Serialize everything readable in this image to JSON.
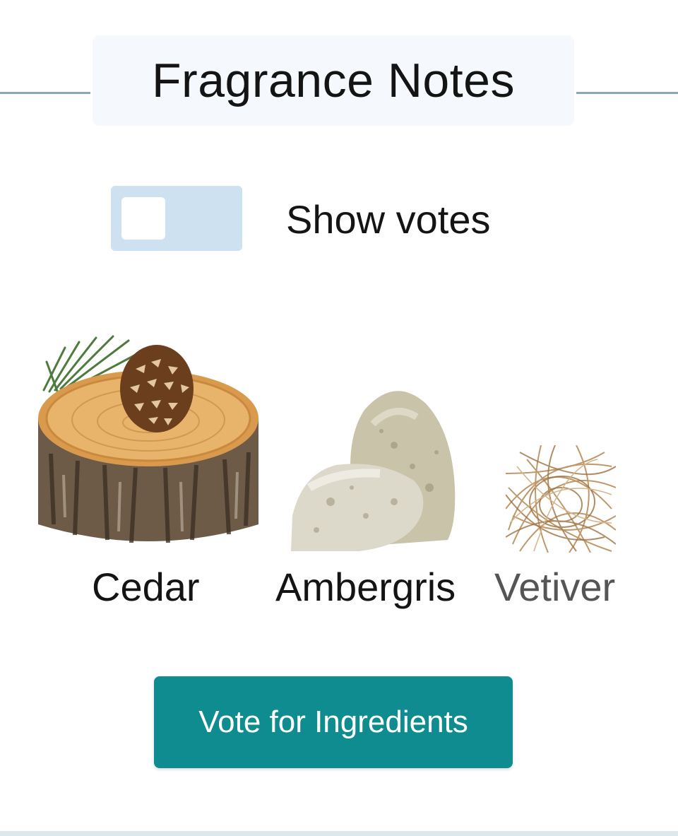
{
  "header": {
    "title": "Fragrance Notes"
  },
  "toggle": {
    "label": "Show votes",
    "state": "off"
  },
  "notes": [
    {
      "name": "Cedar",
      "icon": "cedar-wood-slice-with-pinecone"
    },
    {
      "name": "Ambergris",
      "icon": "ambergris-stones"
    },
    {
      "name": "Vetiver",
      "icon": "vetiver-root-bundle"
    }
  ],
  "actions": {
    "vote_label": "Vote for Ingredients"
  },
  "colors": {
    "accent": "#0f8c8f",
    "toggle_track": "#cde1f0",
    "title_bg": "#f5f8fc",
    "rule": "#8aa6b8",
    "muted_label": "#555555"
  }
}
